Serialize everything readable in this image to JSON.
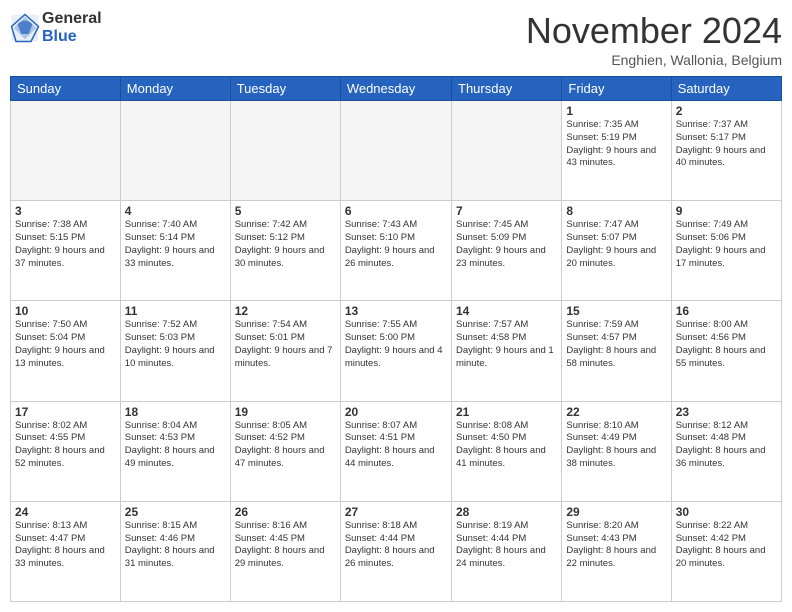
{
  "header": {
    "logo_general": "General",
    "logo_blue": "Blue",
    "month_title": "November 2024",
    "location": "Enghien, Wallonia, Belgium"
  },
  "weekdays": [
    "Sunday",
    "Monday",
    "Tuesday",
    "Wednesday",
    "Thursday",
    "Friday",
    "Saturday"
  ],
  "weeks": [
    [
      {
        "day": "",
        "sunrise": "",
        "sunset": "",
        "daylight": "",
        "empty": true
      },
      {
        "day": "",
        "sunrise": "",
        "sunset": "",
        "daylight": "",
        "empty": true
      },
      {
        "day": "",
        "sunrise": "",
        "sunset": "",
        "daylight": "",
        "empty": true
      },
      {
        "day": "",
        "sunrise": "",
        "sunset": "",
        "daylight": "",
        "empty": true
      },
      {
        "day": "",
        "sunrise": "",
        "sunset": "",
        "daylight": "",
        "empty": true
      },
      {
        "day": "1",
        "sunrise": "Sunrise: 7:35 AM",
        "sunset": "Sunset: 5:19 PM",
        "daylight": "Daylight: 9 hours and 43 minutes."
      },
      {
        "day": "2",
        "sunrise": "Sunrise: 7:37 AM",
        "sunset": "Sunset: 5:17 PM",
        "daylight": "Daylight: 9 hours and 40 minutes."
      }
    ],
    [
      {
        "day": "3",
        "sunrise": "Sunrise: 7:38 AM",
        "sunset": "Sunset: 5:15 PM",
        "daylight": "Daylight: 9 hours and 37 minutes."
      },
      {
        "day": "4",
        "sunrise": "Sunrise: 7:40 AM",
        "sunset": "Sunset: 5:14 PM",
        "daylight": "Daylight: 9 hours and 33 minutes."
      },
      {
        "day": "5",
        "sunrise": "Sunrise: 7:42 AM",
        "sunset": "Sunset: 5:12 PM",
        "daylight": "Daylight: 9 hours and 30 minutes."
      },
      {
        "day": "6",
        "sunrise": "Sunrise: 7:43 AM",
        "sunset": "Sunset: 5:10 PM",
        "daylight": "Daylight: 9 hours and 26 minutes."
      },
      {
        "day": "7",
        "sunrise": "Sunrise: 7:45 AM",
        "sunset": "Sunset: 5:09 PM",
        "daylight": "Daylight: 9 hours and 23 minutes."
      },
      {
        "day": "8",
        "sunrise": "Sunrise: 7:47 AM",
        "sunset": "Sunset: 5:07 PM",
        "daylight": "Daylight: 9 hours and 20 minutes."
      },
      {
        "day": "9",
        "sunrise": "Sunrise: 7:49 AM",
        "sunset": "Sunset: 5:06 PM",
        "daylight": "Daylight: 9 hours and 17 minutes."
      }
    ],
    [
      {
        "day": "10",
        "sunrise": "Sunrise: 7:50 AM",
        "sunset": "Sunset: 5:04 PM",
        "daylight": "Daylight: 9 hours and 13 minutes."
      },
      {
        "day": "11",
        "sunrise": "Sunrise: 7:52 AM",
        "sunset": "Sunset: 5:03 PM",
        "daylight": "Daylight: 9 hours and 10 minutes."
      },
      {
        "day": "12",
        "sunrise": "Sunrise: 7:54 AM",
        "sunset": "Sunset: 5:01 PM",
        "daylight": "Daylight: 9 hours and 7 minutes."
      },
      {
        "day": "13",
        "sunrise": "Sunrise: 7:55 AM",
        "sunset": "Sunset: 5:00 PM",
        "daylight": "Daylight: 9 hours and 4 minutes."
      },
      {
        "day": "14",
        "sunrise": "Sunrise: 7:57 AM",
        "sunset": "Sunset: 4:58 PM",
        "daylight": "Daylight: 9 hours and 1 minute."
      },
      {
        "day": "15",
        "sunrise": "Sunrise: 7:59 AM",
        "sunset": "Sunset: 4:57 PM",
        "daylight": "Daylight: 8 hours and 58 minutes."
      },
      {
        "day": "16",
        "sunrise": "Sunrise: 8:00 AM",
        "sunset": "Sunset: 4:56 PM",
        "daylight": "Daylight: 8 hours and 55 minutes."
      }
    ],
    [
      {
        "day": "17",
        "sunrise": "Sunrise: 8:02 AM",
        "sunset": "Sunset: 4:55 PM",
        "daylight": "Daylight: 8 hours and 52 minutes."
      },
      {
        "day": "18",
        "sunrise": "Sunrise: 8:04 AM",
        "sunset": "Sunset: 4:53 PM",
        "daylight": "Daylight: 8 hours and 49 minutes."
      },
      {
        "day": "19",
        "sunrise": "Sunrise: 8:05 AM",
        "sunset": "Sunset: 4:52 PM",
        "daylight": "Daylight: 8 hours and 47 minutes."
      },
      {
        "day": "20",
        "sunrise": "Sunrise: 8:07 AM",
        "sunset": "Sunset: 4:51 PM",
        "daylight": "Daylight: 8 hours and 44 minutes."
      },
      {
        "day": "21",
        "sunrise": "Sunrise: 8:08 AM",
        "sunset": "Sunset: 4:50 PM",
        "daylight": "Daylight: 8 hours and 41 minutes."
      },
      {
        "day": "22",
        "sunrise": "Sunrise: 8:10 AM",
        "sunset": "Sunset: 4:49 PM",
        "daylight": "Daylight: 8 hours and 38 minutes."
      },
      {
        "day": "23",
        "sunrise": "Sunrise: 8:12 AM",
        "sunset": "Sunset: 4:48 PM",
        "daylight": "Daylight: 8 hours and 36 minutes."
      }
    ],
    [
      {
        "day": "24",
        "sunrise": "Sunrise: 8:13 AM",
        "sunset": "Sunset: 4:47 PM",
        "daylight": "Daylight: 8 hours and 33 minutes."
      },
      {
        "day": "25",
        "sunrise": "Sunrise: 8:15 AM",
        "sunset": "Sunset: 4:46 PM",
        "daylight": "Daylight: 8 hours and 31 minutes."
      },
      {
        "day": "26",
        "sunrise": "Sunrise: 8:16 AM",
        "sunset": "Sunset: 4:45 PM",
        "daylight": "Daylight: 8 hours and 29 minutes."
      },
      {
        "day": "27",
        "sunrise": "Sunrise: 8:18 AM",
        "sunset": "Sunset: 4:44 PM",
        "daylight": "Daylight: 8 hours and 26 minutes."
      },
      {
        "day": "28",
        "sunrise": "Sunrise: 8:19 AM",
        "sunset": "Sunset: 4:44 PM",
        "daylight": "Daylight: 8 hours and 24 minutes."
      },
      {
        "day": "29",
        "sunrise": "Sunrise: 8:20 AM",
        "sunset": "Sunset: 4:43 PM",
        "daylight": "Daylight: 8 hours and 22 minutes."
      },
      {
        "day": "30",
        "sunrise": "Sunrise: 8:22 AM",
        "sunset": "Sunset: 4:42 PM",
        "daylight": "Daylight: 8 hours and 20 minutes."
      }
    ]
  ]
}
